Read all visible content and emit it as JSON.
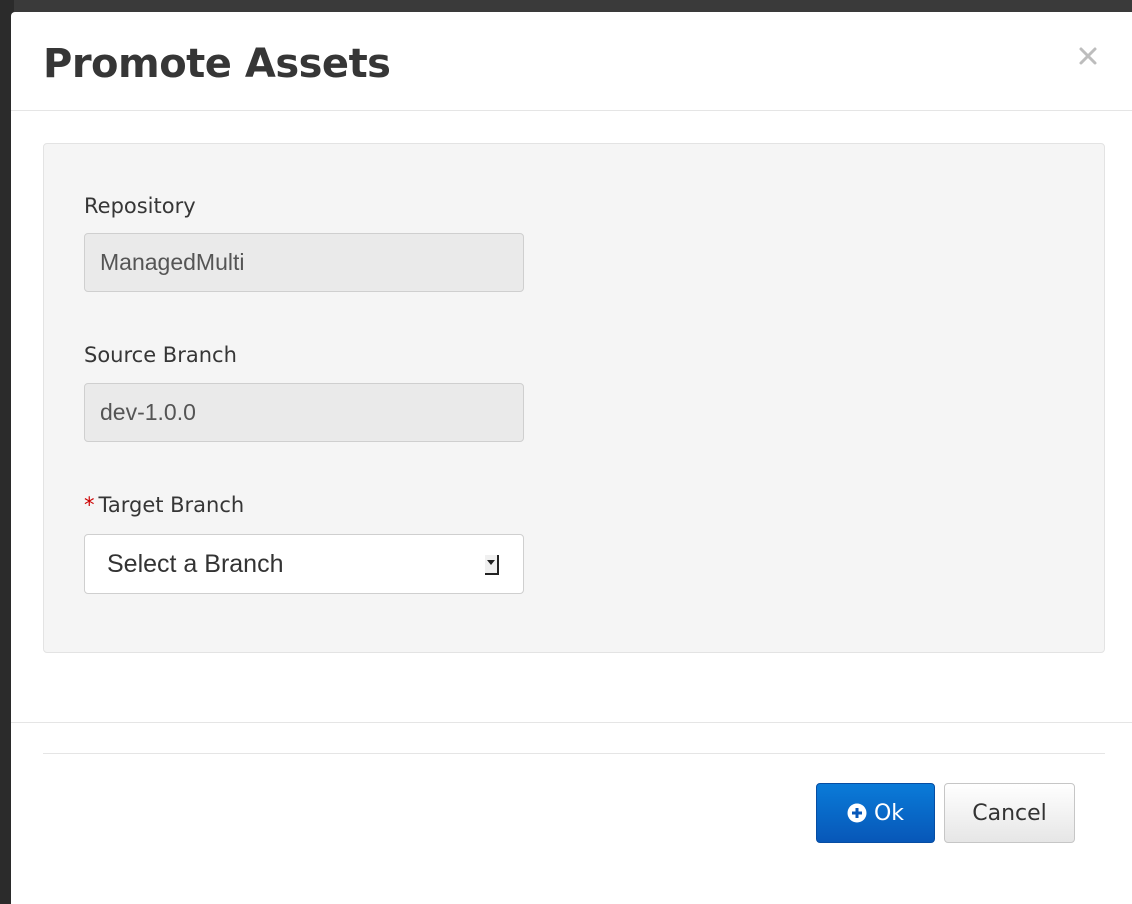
{
  "dialog": {
    "title": "Promote Assets",
    "close_symbol": "×"
  },
  "form": {
    "repository": {
      "label": "Repository",
      "value": "ManagedMulti"
    },
    "source_branch": {
      "label": "Source Branch",
      "value": "dev-1.0.0"
    },
    "target_branch": {
      "required_marker": "*",
      "label": "Target Branch",
      "selected": "Select a Branch"
    }
  },
  "footer": {
    "ok_label": "Ok",
    "ok_icon": "plus-circle-icon",
    "cancel_label": "Cancel"
  },
  "colors": {
    "primary": "#0a7bd8",
    "required": "#cc0000",
    "well_background": "#f5f5f5"
  }
}
